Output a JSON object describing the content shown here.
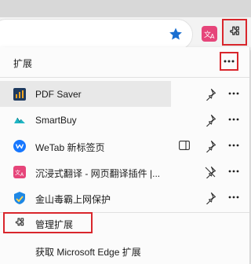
{
  "menu": {
    "title": "扩展",
    "items": [
      {
        "label": "PDF Saver",
        "icon": "pdf-saver-icon",
        "pinned": true
      },
      {
        "label": "SmartBuy",
        "icon": "smartbuy-icon",
        "pinned": false
      },
      {
        "label": "WeTab 新标签页",
        "icon": "wetab-icon",
        "pinned": false
      },
      {
        "label": "沉浸式翻译 - 网页翻译插件 |...",
        "icon": "immersive-translate-icon",
        "pinned": false
      },
      {
        "label": "金山毒霸上网保护",
        "icon": "kingsoft-icon",
        "pinned": false
      }
    ],
    "manage_label": "管理扩展",
    "get_label": "获取 Microsoft Edge 扩展"
  },
  "colors": {
    "highlight_box": "#d9262c",
    "star": "#1a6fd1",
    "immersive_badge": "#e6457a"
  }
}
